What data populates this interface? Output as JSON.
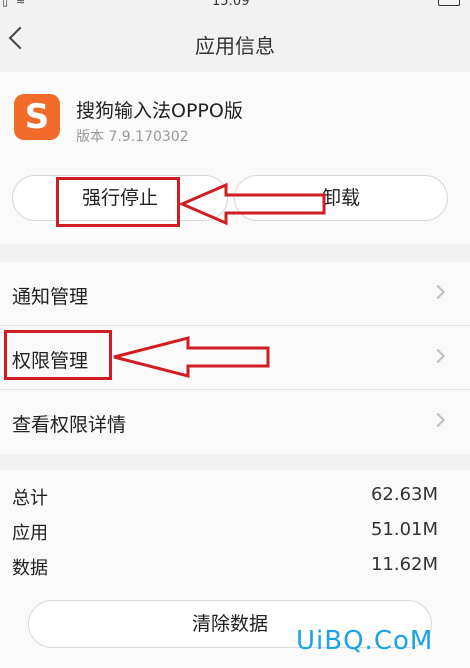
{
  "status_bar": {
    "time": "15:09"
  },
  "header": {
    "title": "应用信息"
  },
  "app": {
    "icon_letter": "S",
    "name": "搜狗输入法OPPO版",
    "version": "版本 7.9.170302"
  },
  "actions": {
    "force_stop": "强行停止",
    "uninstall": "卸载"
  },
  "settings": [
    {
      "label": "通知管理"
    },
    {
      "label": "权限管理"
    },
    {
      "label": "查看权限详情"
    }
  ],
  "storage": {
    "rows": [
      {
        "key": "总计",
        "value": "62.63M"
      },
      {
        "key": "应用",
        "value": "51.01M"
      },
      {
        "key": "数据",
        "value": "11.62M"
      }
    ],
    "clear_data": "清除数据"
  },
  "watermark": "UiBQ.CoM",
  "colors": {
    "annotation": "#d01c23",
    "watermark": "#1aa3e8",
    "app_icon": "#f26b2a"
  }
}
